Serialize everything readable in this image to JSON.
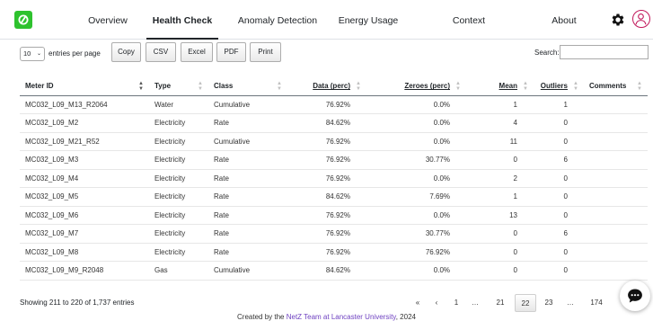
{
  "nav": {
    "tabs": [
      {
        "label": "Overview"
      },
      {
        "label": "Health Check"
      },
      {
        "label": "Anomaly Detection"
      },
      {
        "label": "Energy Usage"
      },
      {
        "label": "Context"
      },
      {
        "label": "About"
      }
    ],
    "active_tab": "Health Check"
  },
  "controls": {
    "page_length": "10",
    "page_length_label": "entries per page",
    "buttons": [
      "Copy",
      "CSV",
      "Excel",
      "PDF",
      "Print"
    ],
    "search_label": "Search:",
    "search_value": ""
  },
  "table": {
    "columns": [
      "Meter ID",
      "Type",
      "Class",
      "Data (perc)",
      "Zeroes (perc)",
      "Mean",
      "Outliers",
      "Comments"
    ],
    "rows": [
      [
        "MC032_L09_M13_R2064",
        "Water",
        "Cumulative",
        "76.92%",
        "0.0%",
        "1",
        "1",
        ""
      ],
      [
        "MC032_L09_M2",
        "Electricity",
        "Rate",
        "84.62%",
        "0.0%",
        "4",
        "0",
        ""
      ],
      [
        "MC032_L09_M21_R52",
        "Electricity",
        "Cumulative",
        "76.92%",
        "0.0%",
        "11",
        "0",
        ""
      ],
      [
        "MC032_L09_M3",
        "Electricity",
        "Rate",
        "76.92%",
        "30.77%",
        "0",
        "6",
        ""
      ],
      [
        "MC032_L09_M4",
        "Electricity",
        "Rate",
        "76.92%",
        "0.0%",
        "2",
        "0",
        ""
      ],
      [
        "MC032_L09_M5",
        "Electricity",
        "Rate",
        "84.62%",
        "7.69%",
        "1",
        "0",
        ""
      ],
      [
        "MC032_L09_M6",
        "Electricity",
        "Rate",
        "76.92%",
        "0.0%",
        "13",
        "0",
        ""
      ],
      [
        "MC032_L09_M7",
        "Electricity",
        "Rate",
        "76.92%",
        "30.77%",
        "0",
        "6",
        ""
      ],
      [
        "MC032_L09_M8",
        "Electricity",
        "Rate",
        "76.92%",
        "76.92%",
        "0",
        "0",
        ""
      ],
      [
        "MC032_L09_M9_R2048",
        "Gas",
        "Cumulative",
        "84.62%",
        "0.0%",
        "0",
        "0",
        ""
      ]
    ]
  },
  "info": {
    "text": "Showing 211 to 220 of 1,737 entries"
  },
  "pagination": {
    "first": "«",
    "prev": "‹",
    "pages": [
      "1",
      "…",
      "21",
      "22",
      "23",
      "…",
      "174"
    ],
    "current": "22"
  },
  "footer": {
    "prefix": "Created by the ",
    "link": "NetZ Team at Lancaster University",
    "suffix": ", 2024"
  },
  "colors": {
    "logo": "#2ec22e",
    "footer_link": "#6f42c1",
    "avatar_ring": "#c2185b"
  }
}
